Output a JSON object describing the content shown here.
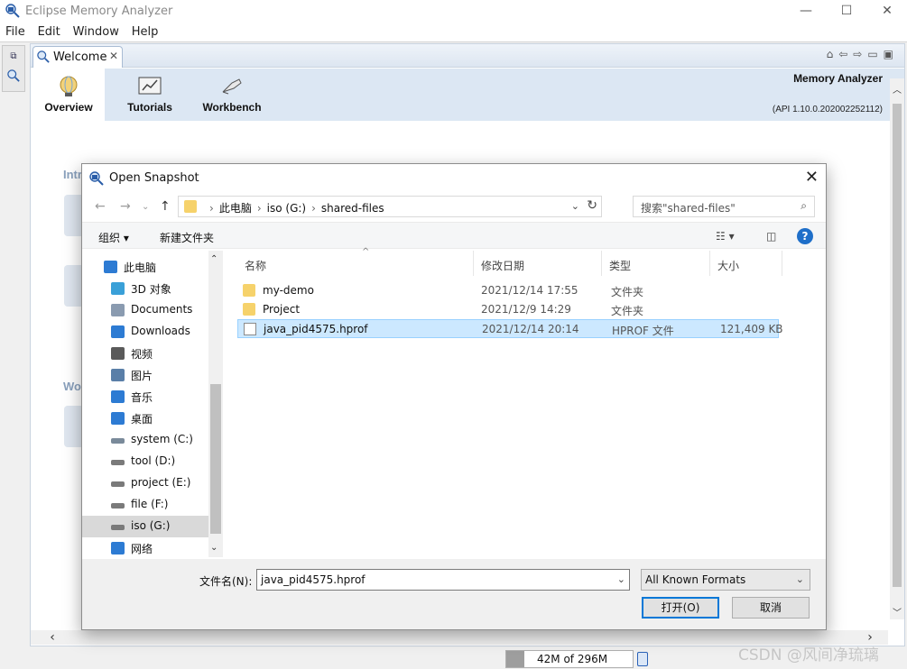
{
  "app": {
    "title": "Eclipse Memory Analyzer",
    "menu": [
      "File",
      "Edit",
      "Window",
      "Help"
    ],
    "window_controls": [
      "—",
      "☐",
      "✕"
    ]
  },
  "editor": {
    "tab_label": "Welcome",
    "tab_close": "✕"
  },
  "welcome": {
    "nav": [
      {
        "label": "Overview",
        "icon": "globe-icon"
      },
      {
        "label": "Tutorials",
        "icon": "chart-board-icon"
      },
      {
        "label": "Workbench",
        "icon": "workbench-icon"
      }
    ],
    "brand": "Memory Analyzer",
    "api": "(API 1.10.0.202002252112)",
    "section_intro_partial": "Intr",
    "section_work_partial": "Wo"
  },
  "status": {
    "heap": "42M of 296M",
    "heap_fraction": 0.142
  },
  "watermark": "CSDN @风间净琉璃",
  "dialog": {
    "title": "Open Snapshot",
    "breadcrumb": [
      "此电脑",
      "iso (G:)",
      "shared-files"
    ],
    "search_placeholder": "搜索\"shared-files\"",
    "toolbar": {
      "organize": "组织 ▾",
      "new_folder": "新建文件夹"
    },
    "nav_items": [
      {
        "label": "此电脑",
        "icon": "computer-icon",
        "color": "#2d7bd3"
      },
      {
        "label": "3D 对象",
        "icon": "cube-icon",
        "color": "#3aa0d8"
      },
      {
        "label": "Documents",
        "icon": "document-icon",
        "color": "#8a9bb0"
      },
      {
        "label": "Downloads",
        "icon": "download-icon",
        "color": "#2d7bd3"
      },
      {
        "label": "视频",
        "icon": "video-icon",
        "color": "#5a5a5a"
      },
      {
        "label": "图片",
        "icon": "picture-icon",
        "color": "#5a7fa8"
      },
      {
        "label": "音乐",
        "icon": "music-icon",
        "color": "#2d7bd3"
      },
      {
        "label": "桌面",
        "icon": "desktop-icon",
        "color": "#2d7bd3"
      },
      {
        "label": "system (C:)",
        "icon": "drive-icon",
        "color": "#7a8a9a"
      },
      {
        "label": "tool (D:)",
        "icon": "drive-icon",
        "color": "#7a7a7a"
      },
      {
        "label": "project (E:)",
        "icon": "drive-icon",
        "color": "#7a7a7a"
      },
      {
        "label": "file (F:)",
        "icon": "drive-icon",
        "color": "#7a7a7a"
      },
      {
        "label": "iso (G:)",
        "icon": "drive-icon",
        "color": "#7a7a7a"
      },
      {
        "label": "网络",
        "icon": "network-icon",
        "color": "#2d7bd3"
      }
    ],
    "columns": [
      "名称",
      "修改日期",
      "类型",
      "大小"
    ],
    "files": [
      {
        "name": "my-demo",
        "modified": "2021/12/14 17:55",
        "type": "文件夹",
        "size": "",
        "kind": "folder"
      },
      {
        "name": "Project",
        "modified": "2021/12/9 14:29",
        "type": "文件夹",
        "size": "",
        "kind": "folder"
      },
      {
        "name": "java_pid4575.hprof",
        "modified": "2021/12/14 20:14",
        "type": "HPROF 文件",
        "size": "121,409 KB",
        "kind": "file"
      }
    ],
    "filename_label": "文件名(N):",
    "filename_value": "java_pid4575.hprof",
    "filter_value": "All Known Formats",
    "open_button": "打开(O)",
    "cancel_button": "取消"
  }
}
